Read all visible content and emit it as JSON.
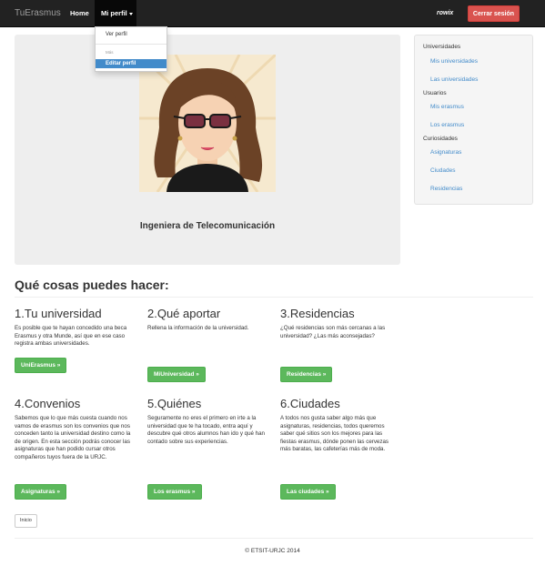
{
  "navbar": {
    "brand": "TuErasmus",
    "home_label": "Home",
    "profile_label": "Mi perfil",
    "username": "rowix",
    "logout_label": "Cerrar sesión"
  },
  "dropdown": {
    "view_profile": "Ver perfil",
    "header": "Más",
    "edit_profile": "Editar perfil"
  },
  "jumbotron": {
    "subtitle": "Ingeniera de Telecomunicación"
  },
  "sidebar": {
    "sections": [
      {
        "heading": "Universidades",
        "links": [
          "Mis universidades",
          "Las universidades"
        ]
      },
      {
        "heading": "Usuarios",
        "links": [
          "Mis erasmus",
          "Los erasmus"
        ]
      },
      {
        "heading": "Curiosidades",
        "links": [
          "Asignaturas",
          "Ciudades",
          "Residencias"
        ]
      }
    ]
  },
  "main": {
    "title": "Qué cosas puedes hacer:",
    "features": [
      {
        "title": "1.Tu universidad",
        "text": "Es posible que te hayan concedido una beca Erasmus y otra Munde, así que en ese caso registra ambas universidades.",
        "button": "UniErasmus »"
      },
      {
        "title": "2.Qué aportar",
        "text": "Rellena la información de la universidad.",
        "button": "MiUniversidad »"
      },
      {
        "title": "3.Residencias",
        "text": "¿Qué residencias son más cercanas a las universidad? ¿Las más aconsejadas?",
        "button": "Residencias »"
      },
      {
        "title": "4.Convenios",
        "text": "Sabemos que lo que más cuesta cuando nos vamos de erasmus son los convenios que nos conceden tanto la universidad destino como la de origen. En esta sección podrás conocer las asignaturas que han podido cursar otros compañeros tuyos fuera de la URJC.",
        "button": "Asignaturas »"
      },
      {
        "title": "5.Quiénes",
        "text": "Seguramente no eres el primero en irte a la universidad que te ha tocado, entra aquí y descubre qué otros alumnos han ido y qué han contado sobre sus experiencias.",
        "button": "Los erasmus »"
      },
      {
        "title": "6.Ciudades",
        "text": "A todos nos gusta saber algo más que asignaturas, residencias, todos queremos saber qué sitios son los mejores para las fiestas erasmus, dónde ponen las cervezas más baratas, las cafeterías más de moda.",
        "button": "Las ciudades »"
      }
    ],
    "start_button": "Inicio"
  },
  "footer": {
    "text": "© ETSIT-URJC 2014"
  },
  "colors": {
    "navbar": "#222222",
    "danger": "#d9534f",
    "success": "#5cb85c",
    "link": "#428bca",
    "jumbotron": "#eeeeee"
  }
}
